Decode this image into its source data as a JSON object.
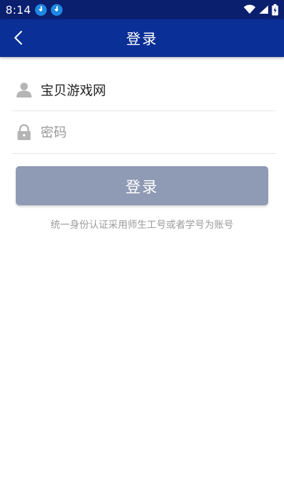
{
  "status_bar": {
    "time": "8:14",
    "icons": [
      "download-icon",
      "download-icon",
      "wifi-icon",
      "signal-icon",
      "battery-charging-icon"
    ]
  },
  "header": {
    "title": "登录",
    "back_icon": "chevron-left-icon"
  },
  "form": {
    "username": {
      "value": "宝贝游戏网",
      "icon": "user-icon"
    },
    "password": {
      "placeholder": "密码",
      "icon": "lock-icon"
    },
    "submit_label": "登录",
    "hint": "统一身份认证采用师生工号或者学号为账号"
  },
  "colors": {
    "status_bar": "#0a1f6e",
    "header": "#0a2f96",
    "button_disabled": "#8f9ab4",
    "icon_gray": "#b5b5b5"
  }
}
